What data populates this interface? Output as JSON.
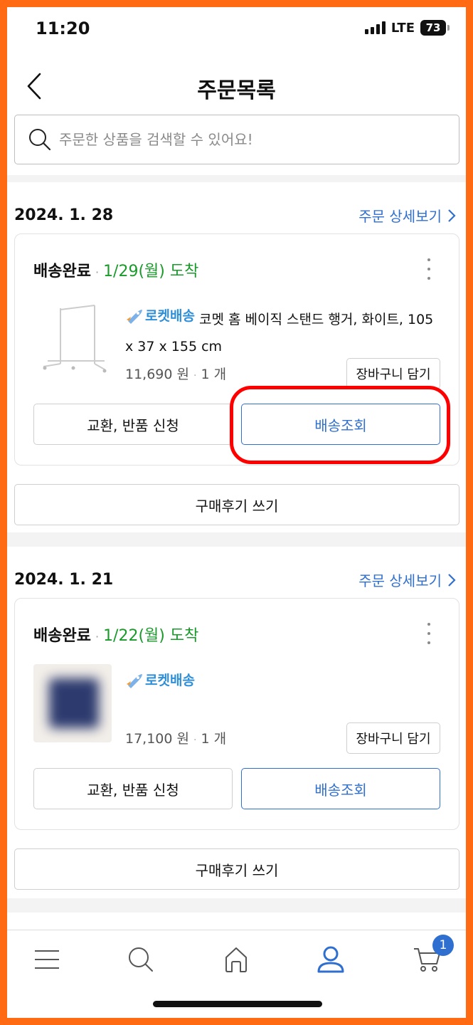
{
  "status_bar": {
    "time": "11:20",
    "network": "LTE",
    "battery": "73"
  },
  "header": {
    "title": "주문목록"
  },
  "search": {
    "placeholder": "주문한 상품을 검색할 수 있어요!"
  },
  "colors": {
    "accent": "#2f6fd0",
    "arrival_green": "#1a9a2b",
    "highlight": "#ff0000",
    "frame": "#ff6a13"
  },
  "orders": [
    {
      "date": "2024. 1. 28",
      "detail_label": "주문 상세보기",
      "status": "배송완료",
      "arrival": "1/29(월) 도착",
      "badge": "로켓배송",
      "product_name": "코멧 홈 베이직 스탠드 행거, 화이트, 105 x 37 x 155 cm",
      "price": "11,690 원",
      "qty": "1 개",
      "cart_label": "장바구니 담기",
      "return_label": "교환, 반품 신청",
      "track_label": "배송조회",
      "review_label": "구매후기 쓰기"
    },
    {
      "date": "2024. 1. 21",
      "detail_label": "주문 상세보기",
      "status": "배송완료",
      "arrival": "1/22(월) 도착",
      "badge": "로켓배송",
      "product_name": "",
      "price": "17,100 원",
      "qty": "1 개",
      "cart_label": "장바구니 담기",
      "return_label": "교환, 반품 신청",
      "track_label": "배송조회",
      "review_label": "구매후기 쓰기"
    }
  ],
  "bottom_nav": {
    "items": [
      "menu-icon",
      "search-icon",
      "home-icon",
      "profile-icon",
      "cart-icon"
    ],
    "cart_badge": "1"
  }
}
